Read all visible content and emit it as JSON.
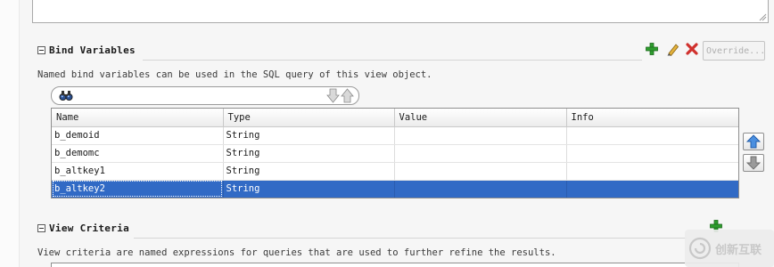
{
  "bind_variables": {
    "title": "Bind Variables",
    "description": "Named bind variables can be used in the SQL query of this view object.",
    "override_label": "Override...",
    "columns": [
      "Name",
      "Type",
      "Value",
      "Info"
    ],
    "rows": [
      {
        "name": "b_demoid",
        "type": "String",
        "value": "",
        "info": ""
      },
      {
        "name": "b_demomc",
        "type": "String",
        "value": "",
        "info": ""
      },
      {
        "name": "b_altkey1",
        "type": "String",
        "value": "",
        "info": ""
      },
      {
        "name": "b_altkey2",
        "type": "String",
        "value": "",
        "info": ""
      }
    ],
    "selected_row": 3
  },
  "view_criteria": {
    "title": "View Criteria",
    "description": "View criteria are named expressions for queries that are used to further refine the results."
  },
  "watermark": {
    "text": "创新互联"
  },
  "colors": {
    "selection": "#316ac5",
    "add": "#2e9d2e",
    "delete": "#d0312d",
    "edit": "#c98a1b"
  }
}
